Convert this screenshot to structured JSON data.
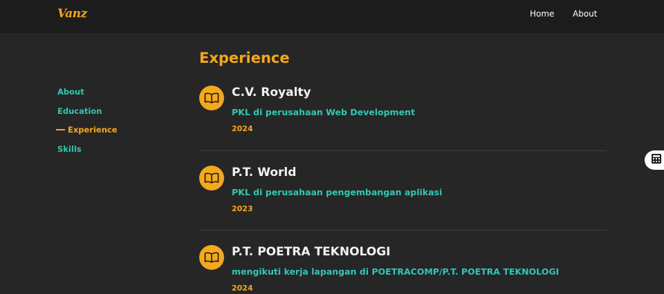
{
  "header": {
    "logo": "Vanz",
    "nav": [
      "Home",
      "About"
    ]
  },
  "sidebar": {
    "items": [
      {
        "label": "About",
        "active": false
      },
      {
        "label": "Education",
        "active": false
      },
      {
        "label": "Experience",
        "active": true
      },
      {
        "label": "Skills",
        "active": false
      }
    ]
  },
  "main": {
    "title": "Experience",
    "items": [
      {
        "company": "C.V. Royalty",
        "description": "PKL di perusahaan Web Development",
        "year": "2024",
        "icon": "book-icon"
      },
      {
        "company": "P.T. World",
        "description": "PKL di perusahaan pengembangan aplikasi",
        "year": "2023",
        "icon": "book-icon"
      },
      {
        "company": "P.T. POETRA TEKNOLOGI",
        "description": "mengikuti kerja lapangan di POETRACOMP/P.T. POETRA TEKNOLOGI",
        "year": "2024",
        "icon": "book-icon"
      }
    ]
  },
  "floating_button": {
    "icon": "calculator-icon"
  },
  "colors": {
    "accent": "#f4a81d",
    "teal": "#33c6b4",
    "background": "#262626",
    "header": "#1c1c1c"
  }
}
